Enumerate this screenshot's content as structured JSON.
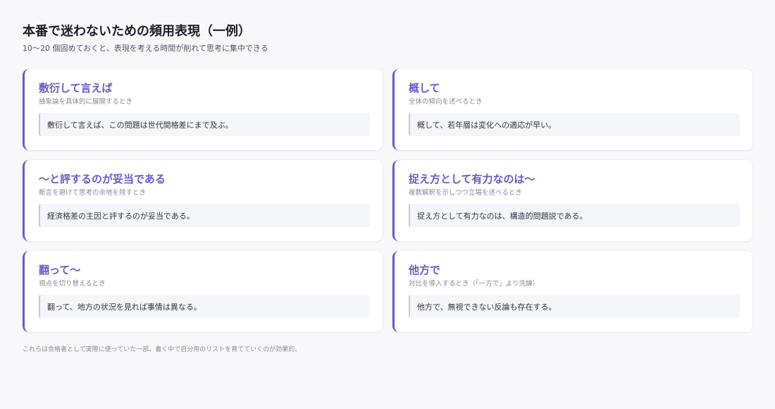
{
  "header": {
    "title": "本番で迷わないための頻用表現（一例）",
    "subtitle": "10〜20 個固めておくと、表現を考える時間が削れて思考に集中できる"
  },
  "cards": [
    {
      "title": "敷衍して言えば",
      "usage": "抽象論を具体的に展開するとき",
      "example": "敷衍して言えば、この問題は世代間格差にまで及ぶ。"
    },
    {
      "title": "概して",
      "usage": "全体の傾向を述べるとき",
      "example": "概して、若年層は変化への適応が早い。"
    },
    {
      "title": "〜と評するのが妥当である",
      "usage": "断言を避けて思考の余地を残すとき",
      "example": "経済格差の主因と評するのが妥当である。"
    },
    {
      "title": "捉え方として有力なのは〜",
      "usage": "複数解釈を示しつつ立場を述べるとき",
      "example": "捉え方として有力なのは、構造的問題説である。"
    },
    {
      "title": "翻って〜",
      "usage": "視点を切り替えるとき",
      "example": "翻って、地方の状況を見れば事情は異なる。"
    },
    {
      "title": "他方で",
      "usage": "対比を導入するとき（「一方で」より洗練）",
      "example": "他方で、無視できない反論も存在する。"
    }
  ],
  "footer": {
    "note": "これらは合格者として実際に使っていた一部。書く中で自分用のリストを育てていくのが効果的。"
  }
}
